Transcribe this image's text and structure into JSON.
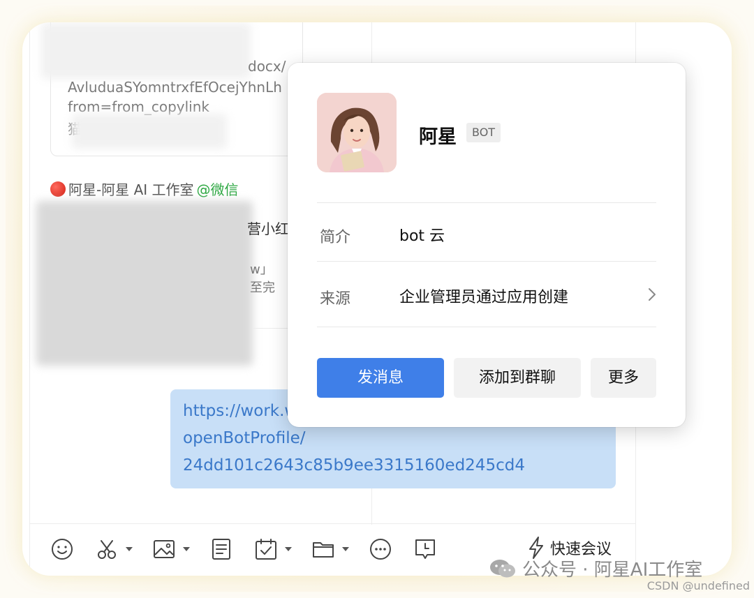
{
  "chat": {
    "link_card": {
      "line1": "docx/",
      "line2": "AvluduaSYomntrxfEfOcejYhnLh",
      "line3": "from=from_copylink",
      "line4_fragment": "猫"
    },
    "sender": {
      "name": "阿星-阿星 AI 工作室",
      "source": "@微信"
    },
    "message_fragments": {
      "frag1": "营小红",
      "frag2": "w」",
      "frag3": "至完"
    },
    "link_bubble": {
      "line1": "https://work.w",
      "line2": "openBotProfile/",
      "line3": "24dd101c2643c85b9ee3315160ed245cd4"
    }
  },
  "toolbar": {
    "icons": [
      "emoji-icon",
      "scissors-icon",
      "image-icon",
      "document-icon",
      "calendar-check-icon",
      "folder-icon",
      "more-icon",
      "message-clock-icon"
    ],
    "quick_meeting_label": "快速会议"
  },
  "bot_profile": {
    "name": "阿星",
    "badge": "BOT",
    "intro_label": "简介",
    "intro_value": "bot 云",
    "source_label": "来源",
    "source_value": "企业管理员通过应用创建",
    "buttons": {
      "send_message": "发消息",
      "add_to_group": "添加到群聊",
      "more": "更多"
    }
  },
  "watermark": {
    "wechat_account": "公众号 · 阿星AI工作室",
    "csdn": "CSDN @undefined"
  },
  "colors": {
    "primary_button": "#3f7fe8",
    "link_bubble_bg": "#c8dff7",
    "link_text": "#3a78c9",
    "at_source": "#2ea843"
  }
}
